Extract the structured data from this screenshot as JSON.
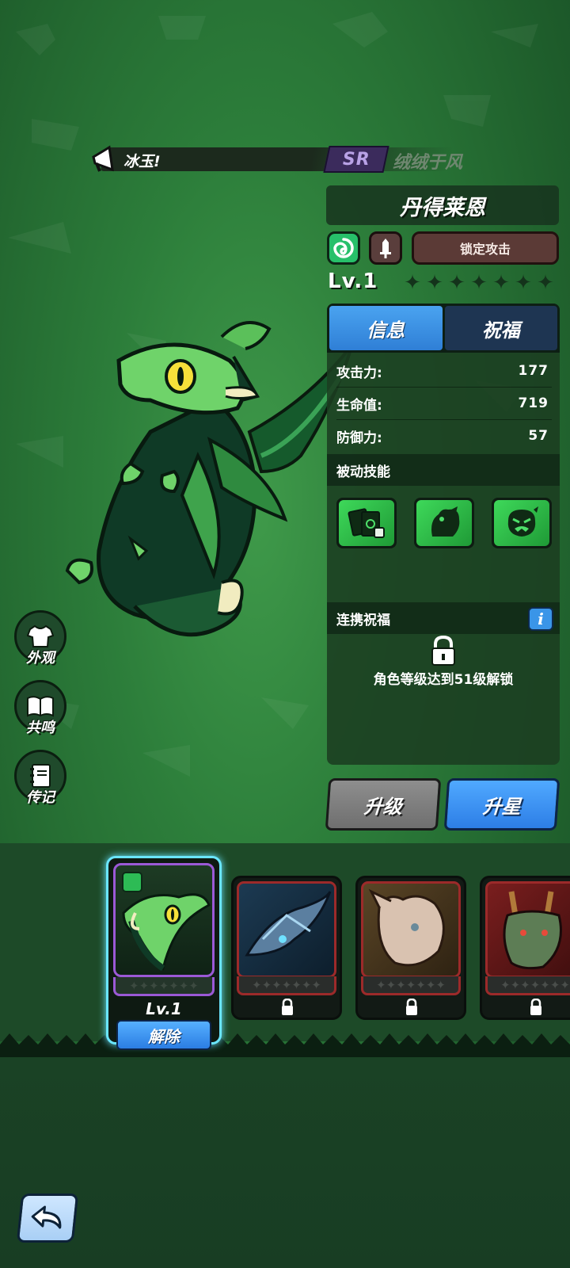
{
  "banner": {
    "text_prefix": "",
    "text_highlight": "冰玉!",
    "rarity": "SR",
    "hero_name": "绒绒于风"
  },
  "hero": {
    "name": "丹得莱恩",
    "lock_attack_label": "锁定攻击",
    "level_label": "Lv.1",
    "stars_filled": 0,
    "stars_total": 7
  },
  "tabs": [
    {
      "label": "信息",
      "active": true
    },
    {
      "label": "祝福",
      "active": false
    }
  ],
  "stats": [
    {
      "label": "攻击力:",
      "value": "177"
    },
    {
      "label": "生命值:",
      "value": "719"
    },
    {
      "label": "防御力:",
      "value": "57"
    }
  ],
  "passive_skills_label": "被动技能",
  "bond_blessing": {
    "label": "连携祝福",
    "info_icon": "i",
    "lock_message": "角色等级达到51级解锁"
  },
  "actions": {
    "upgrade": "升级",
    "star_up": "升星"
  },
  "side_menu": [
    {
      "label": "外观",
      "icon": "shirt-icon"
    },
    {
      "label": "共鸣",
      "icon": "book-icon"
    },
    {
      "label": "传记",
      "icon": "notebook-icon"
    }
  ],
  "roster": {
    "selected": {
      "level": "Lv.1",
      "action": "解除"
    },
    "locked_count": 3
  },
  "colors": {
    "accent_blue": "#3a95e8",
    "rarity_purple": "#9b59d6",
    "locked_red": "#9c2a2a",
    "element_green": "#27c06a"
  }
}
